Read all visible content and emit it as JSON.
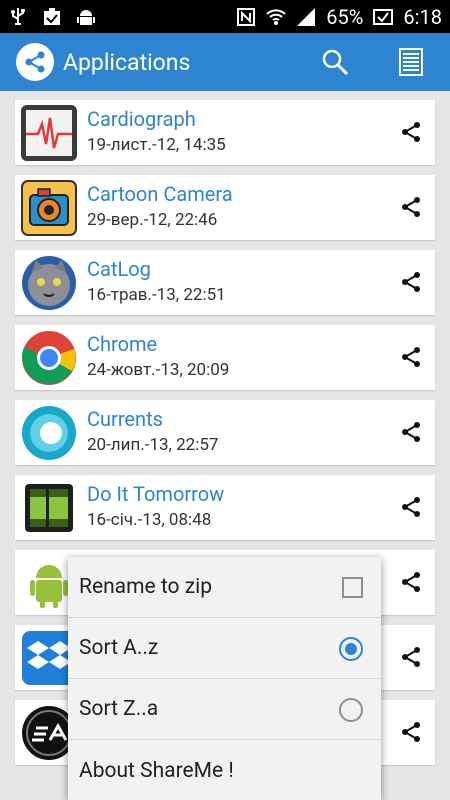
{
  "status_bar": {
    "battery": "65%",
    "time": "6:18",
    "left_icons": [
      "usb-icon",
      "task-check-icon",
      "android-debug-icon"
    ],
    "right_icons": [
      "nfc-icon",
      "wifi-icon",
      "signal-icon",
      "battery-icon"
    ]
  },
  "action_bar": {
    "title": "Applications",
    "color": "#2f84cf",
    "actions": [
      "search-icon",
      "list-view-icon"
    ]
  },
  "apps": [
    {
      "name": "Cardiograph",
      "date": "19-лист.-12, 14:35",
      "icon": "cardiograph-app-icon"
    },
    {
      "name": "Cartoon Camera",
      "date": "29-вер.-12, 22:46",
      "icon": "cartoon-camera-app-icon"
    },
    {
      "name": "CatLog",
      "date": "16-трав.-13, 22:51",
      "icon": "catlog-app-icon"
    },
    {
      "name": "Chrome",
      "date": "24-жовт.-13, 20:09",
      "icon": "chrome-app-icon"
    },
    {
      "name": "Currents",
      "date": "20-лип.-13, 22:57",
      "icon": "currents-app-icon"
    },
    {
      "name": "Do It Tomorrow",
      "date": "16-січ.-13, 08:48",
      "icon": "do-it-tomorrow-app-icon"
    },
    {
      "name": "",
      "date": "",
      "icon": "android-app-icon"
    },
    {
      "name": "",
      "date": "",
      "icon": "dropbox-app-icon"
    },
    {
      "name": "",
      "date": "",
      "icon": "ea-app-icon"
    }
  ],
  "menu": {
    "items": [
      {
        "label": "Rename to zip",
        "control": "checkbox",
        "checked": false
      },
      {
        "label": "Sort A..z",
        "control": "radio",
        "checked": true
      },
      {
        "label": "Sort Z..a",
        "control": "radio",
        "checked": false
      },
      {
        "label": "About ShareMe !",
        "control": "none"
      }
    ]
  }
}
